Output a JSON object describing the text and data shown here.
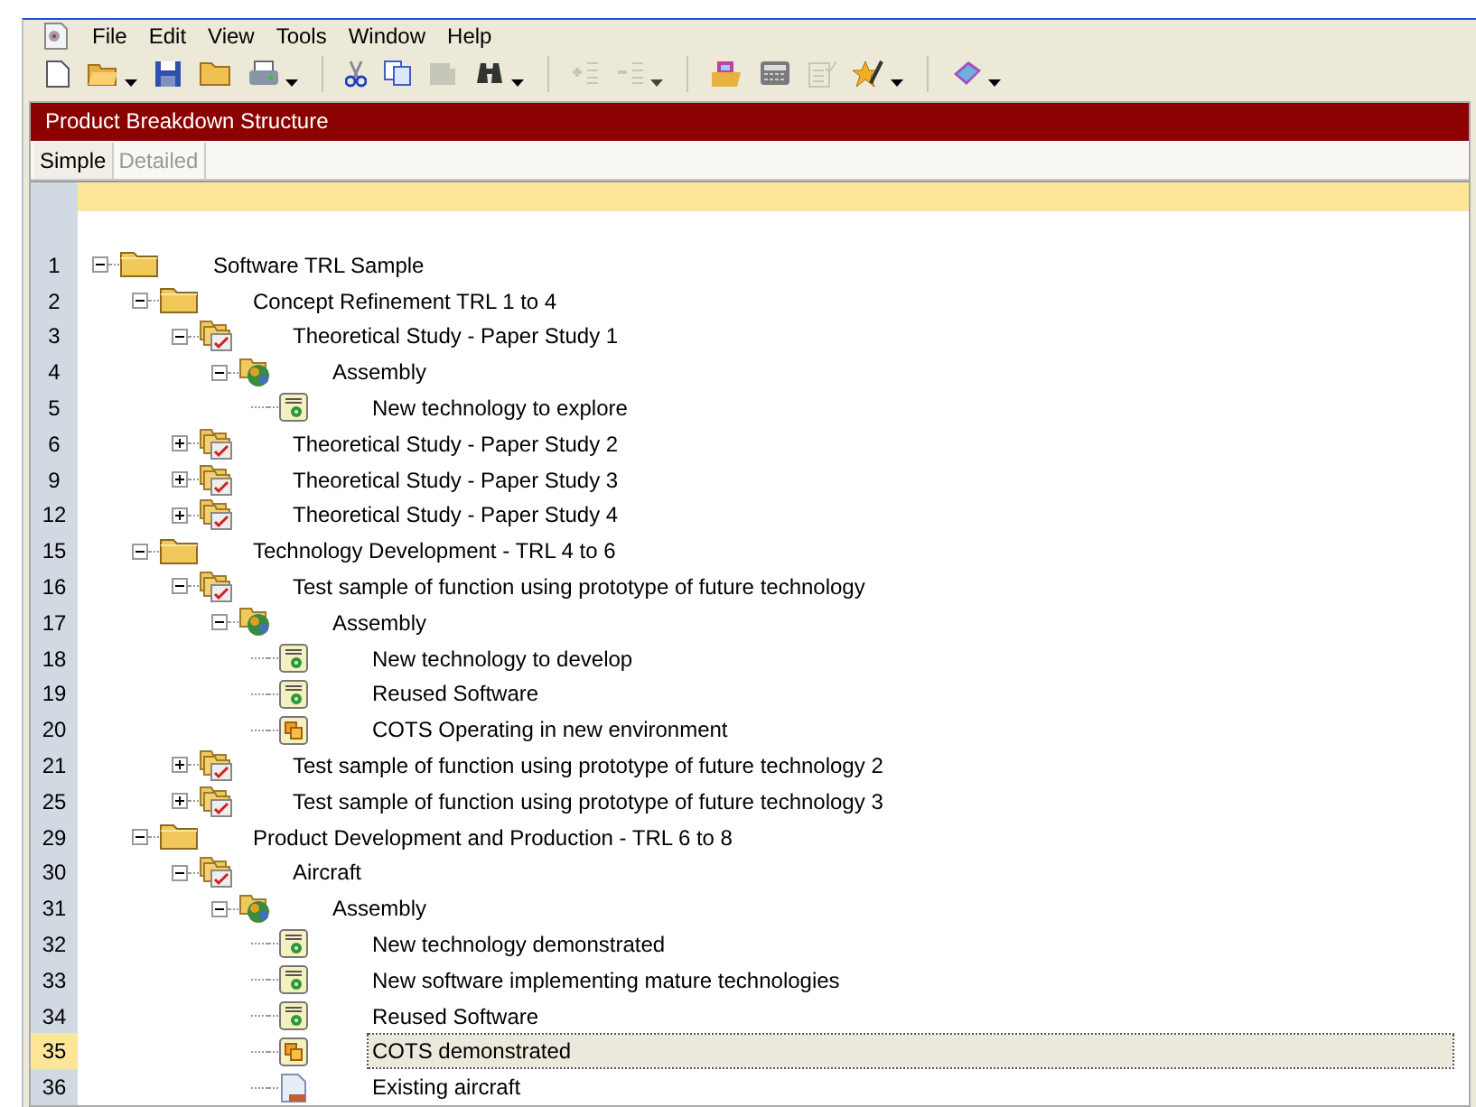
{
  "menu": [
    "File",
    "Edit",
    "View",
    "Tools",
    "Window",
    "Help"
  ],
  "toolbar": [
    {
      "kind": "new",
      "disabled": false,
      "dropdown": false
    },
    {
      "kind": "open",
      "disabled": false,
      "dropdown": true
    },
    {
      "kind": "save",
      "disabled": false,
      "dropdown": false
    },
    {
      "kind": "folder",
      "disabled": false,
      "dropdown": false
    },
    {
      "kind": "print",
      "disabled": false,
      "dropdown": true
    },
    {
      "kind": "sep"
    },
    {
      "kind": "cut",
      "disabled": false,
      "dropdown": false
    },
    {
      "kind": "copy",
      "disabled": false,
      "dropdown": false
    },
    {
      "kind": "paste",
      "disabled": true,
      "dropdown": false
    },
    {
      "kind": "find",
      "disabled": false,
      "dropdown": true
    },
    {
      "kind": "sep"
    },
    {
      "kind": "indent",
      "disabled": true,
      "dropdown": false
    },
    {
      "kind": "outdent",
      "disabled": true,
      "dropdown": true
    },
    {
      "kind": "sep"
    },
    {
      "kind": "report",
      "disabled": false,
      "dropdown": false
    },
    {
      "kind": "calculator",
      "disabled": false,
      "dropdown": false
    },
    {
      "kind": "checklist",
      "disabled": true,
      "dropdown": false
    },
    {
      "kind": "star",
      "disabled": false,
      "dropdown": true
    },
    {
      "kind": "sep"
    },
    {
      "kind": "help",
      "disabled": false,
      "dropdown": true
    }
  ],
  "panel": {
    "title": "Product Breakdown Structure"
  },
  "tabs": [
    {
      "label": "Simple",
      "selected": true
    },
    {
      "label": "Detailed",
      "selected": false
    }
  ],
  "tree": [
    {
      "line": "1",
      "label": "Software TRL Sample",
      "kind": "folder",
      "expanded": true,
      "selected": false,
      "children": [
        {
          "line": "2",
          "label": "Concept Refinement TRL 1 to 4",
          "kind": "folder",
          "expanded": true,
          "selected": false,
          "children": [
            {
              "line": "3",
              "label": "Theoretical Study - Paper Study 1",
              "kind": "study",
              "expanded": true,
              "selected": false,
              "children": [
                {
                  "line": "4",
                  "label": "Assembly",
                  "kind": "assembly",
                  "expanded": true,
                  "selected": false,
                  "children": [
                    {
                      "line": "5",
                      "label": "New technology to explore",
                      "kind": "software",
                      "selected": false
                    }
                  ]
                }
              ]
            },
            {
              "line": "6",
              "label": "Theoretical Study - Paper Study 2",
              "kind": "study",
              "expanded": false,
              "selected": false
            },
            {
              "line": "9",
              "label": "Theoretical Study - Paper Study 3",
              "kind": "study",
              "expanded": false,
              "selected": false
            },
            {
              "line": "12",
              "label": "Theoretical Study - Paper Study 4",
              "kind": "study",
              "expanded": false,
              "selected": false
            }
          ]
        },
        {
          "line": "15",
          "label": "Technology Development - TRL 4 to 6",
          "kind": "folder",
          "expanded": true,
          "selected": false,
          "children": [
            {
              "line": "16",
              "label": "Test sample of function using prototype of future technology",
              "kind": "study",
              "expanded": true,
              "selected": false,
              "children": [
                {
                  "line": "17",
                  "label": "Assembly",
                  "kind": "assembly",
                  "expanded": true,
                  "selected": false,
                  "children": [
                    {
                      "line": "18",
                      "label": "New technology to develop",
                      "kind": "software",
                      "selected": false
                    },
                    {
                      "line": "19",
                      "label": "Reused Software",
                      "kind": "software",
                      "selected": false
                    },
                    {
                      "line": "20",
                      "label": "COTS Operating in new environment",
                      "kind": "cots",
                      "selected": false
                    }
                  ]
                }
              ]
            },
            {
              "line": "21",
              "label": "Test sample of function using prototype of future technology 2",
              "kind": "study",
              "expanded": false,
              "selected": false
            },
            {
              "line": "25",
              "label": "Test sample of function using prototype of future technology 3",
              "kind": "study",
              "expanded": false,
              "selected": false
            }
          ]
        },
        {
          "line": "29",
          "label": "Product Development and Production - TRL 6 to 8",
          "kind": "folder",
          "expanded": true,
          "selected": false,
          "children": [
            {
              "line": "30",
              "label": "Aircraft",
              "kind": "study",
              "expanded": true,
              "selected": false,
              "children": [
                {
                  "line": "31",
                  "label": "Assembly",
                  "kind": "assembly",
                  "expanded": true,
                  "selected": false,
                  "children": [
                    {
                      "line": "32",
                      "label": "New technology demonstrated",
                      "kind": "software",
                      "selected": false
                    },
                    {
                      "line": "33",
                      "label": "New software implementing mature technologies",
                      "kind": "software",
                      "selected": false
                    },
                    {
                      "line": "34",
                      "label": "Reused Software",
                      "kind": "software",
                      "selected": false
                    },
                    {
                      "line": "35",
                      "label": "COTS demonstrated",
                      "kind": "cots",
                      "selected": true
                    },
                    {
                      "line": "36",
                      "label": "Existing aircraft",
                      "kind": "document",
                      "selected": false
                    }
                  ]
                }
              ]
            }
          ]
        }
      ]
    }
  ]
}
